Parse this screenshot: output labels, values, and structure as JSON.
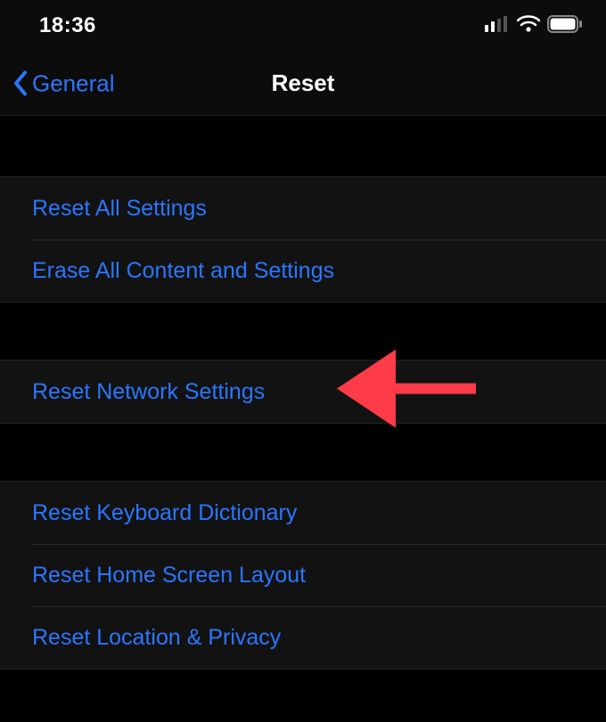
{
  "status": {
    "time": "18:36"
  },
  "nav": {
    "back_label": "General",
    "title": "Reset"
  },
  "groups": {
    "g1": {
      "r1": "Reset All Settings",
      "r2": "Erase All Content and Settings"
    },
    "g2": {
      "r1": "Reset Network Settings"
    },
    "g3": {
      "r1": "Reset Keyboard Dictionary",
      "r2": "Reset Home Screen Layout",
      "r3": "Reset Location & Privacy"
    }
  }
}
